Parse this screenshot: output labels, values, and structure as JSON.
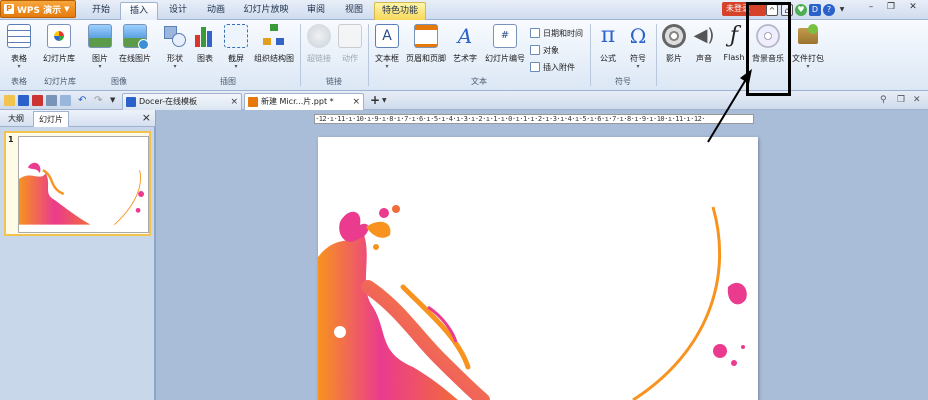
{
  "app": {
    "name": "WPS 演示"
  },
  "menu_tabs": [
    {
      "label": "开始"
    },
    {
      "label": "插入"
    },
    {
      "label": "设计"
    },
    {
      "label": "动画"
    },
    {
      "label": "幻灯片放映"
    },
    {
      "label": "审阅"
    },
    {
      "label": "视图"
    },
    {
      "label": "特色功能"
    }
  ],
  "unregistered_label": "未登录",
  "ribbon": {
    "buttons": [
      {
        "label": "表格"
      },
      {
        "label": "幻灯片库"
      },
      {
        "label": "图片"
      },
      {
        "label": "在线图片"
      },
      {
        "label": "形状"
      },
      {
        "label": "图表"
      },
      {
        "label": "截屏"
      },
      {
        "label": "组织结构图"
      },
      {
        "label": "超链接"
      },
      {
        "label": "动作"
      },
      {
        "label": "文本框"
      },
      {
        "label": "页眉和页脚"
      },
      {
        "label": "艺术字"
      },
      {
        "label": "幻灯片编号"
      },
      {
        "label": "公式"
      },
      {
        "label": "符号"
      },
      {
        "label": "影片"
      },
      {
        "label": "声音"
      },
      {
        "label": "Flash"
      },
      {
        "label": "背景音乐"
      },
      {
        "label": "文件打包"
      }
    ],
    "small_buttons": [
      {
        "label": "日期和时间"
      },
      {
        "label": "对象"
      },
      {
        "label": "插入附件"
      }
    ],
    "groups": [
      {
        "label": "表格"
      },
      {
        "label": "幻灯片库"
      },
      {
        "label": "图像"
      },
      {
        "label": "插图"
      },
      {
        "label": "链接"
      },
      {
        "label": "文本"
      },
      {
        "label": "符号"
      }
    ]
  },
  "doc_tabs": [
    {
      "label": "Docer-在线模板"
    },
    {
      "label": "新建 Micr...片.ppt *"
    }
  ],
  "panel": {
    "tabs": [
      {
        "label": "大纲"
      },
      {
        "label": "幻灯片"
      }
    ],
    "close_glyph": "×",
    "slide_number": "1"
  },
  "ruler_text": "·12·ı·11·ı·10·ı·9·ı·8·ı·7·ı·6·ı·5·ı·4·ı·3·ı·2·ı·1·ı·0·ı·1·ı·2·ı·3·ı·4·ı·5·ı·6·ı·7·ı·8·ı·9·ı·10·ı·11·ı·12·",
  "colors": {
    "accent": "#e57a0b",
    "ribbon": "#dce7f5",
    "splash_pink": "#ea3b8e",
    "splash_orange": "#f7931e"
  }
}
